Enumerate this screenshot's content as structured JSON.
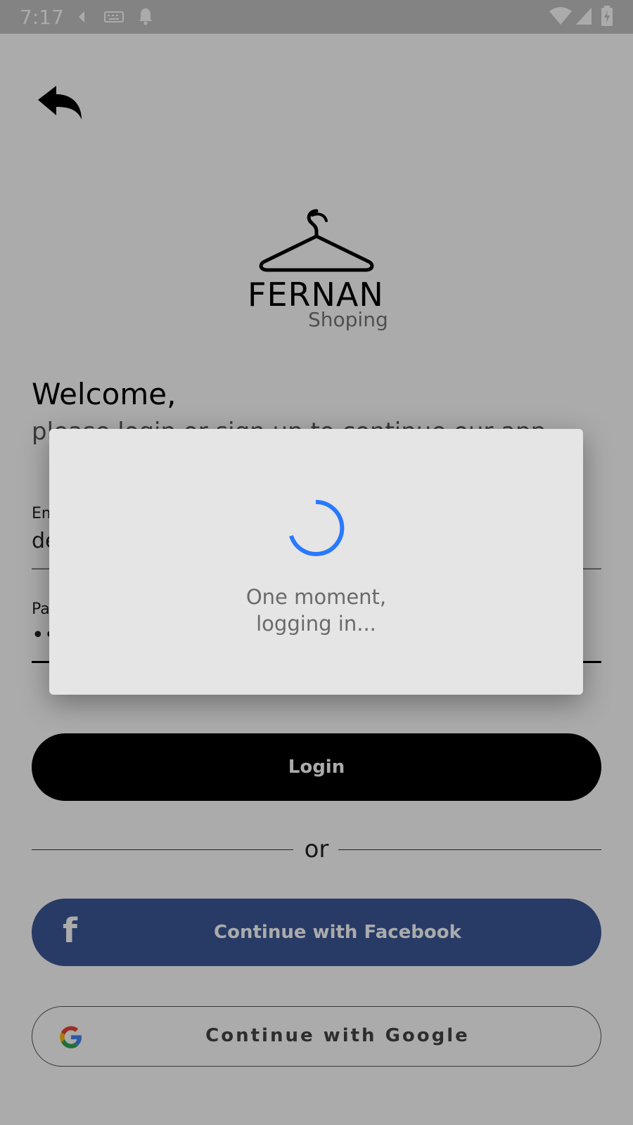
{
  "status_bar": {
    "time": "7:17",
    "icons": [
      "back-chevron-icon",
      "keyboard-icon",
      "bell-icon",
      "wifi-icon",
      "signal-icon",
      "battery-charging-icon"
    ]
  },
  "logo": {
    "brand": "FERNAN",
    "tagline": "Shoping",
    "icon": "hanger-icon"
  },
  "header": {
    "welcome": "Welcome,",
    "subtitle": "please login or sign up to continue our app"
  },
  "form": {
    "email_label": "Email",
    "email_value": "de",
    "password_label": "Password",
    "password_value": "•••••••••"
  },
  "buttons": {
    "login": "Login",
    "or": "or",
    "facebook": "Continue with Facebook",
    "google": "Continue with Google"
  },
  "dialog": {
    "line1": "One moment,",
    "line2": "logging in..."
  },
  "colors": {
    "facebook": "#3b5998",
    "spinner": "#2979ff",
    "primary_button": "#000000"
  }
}
